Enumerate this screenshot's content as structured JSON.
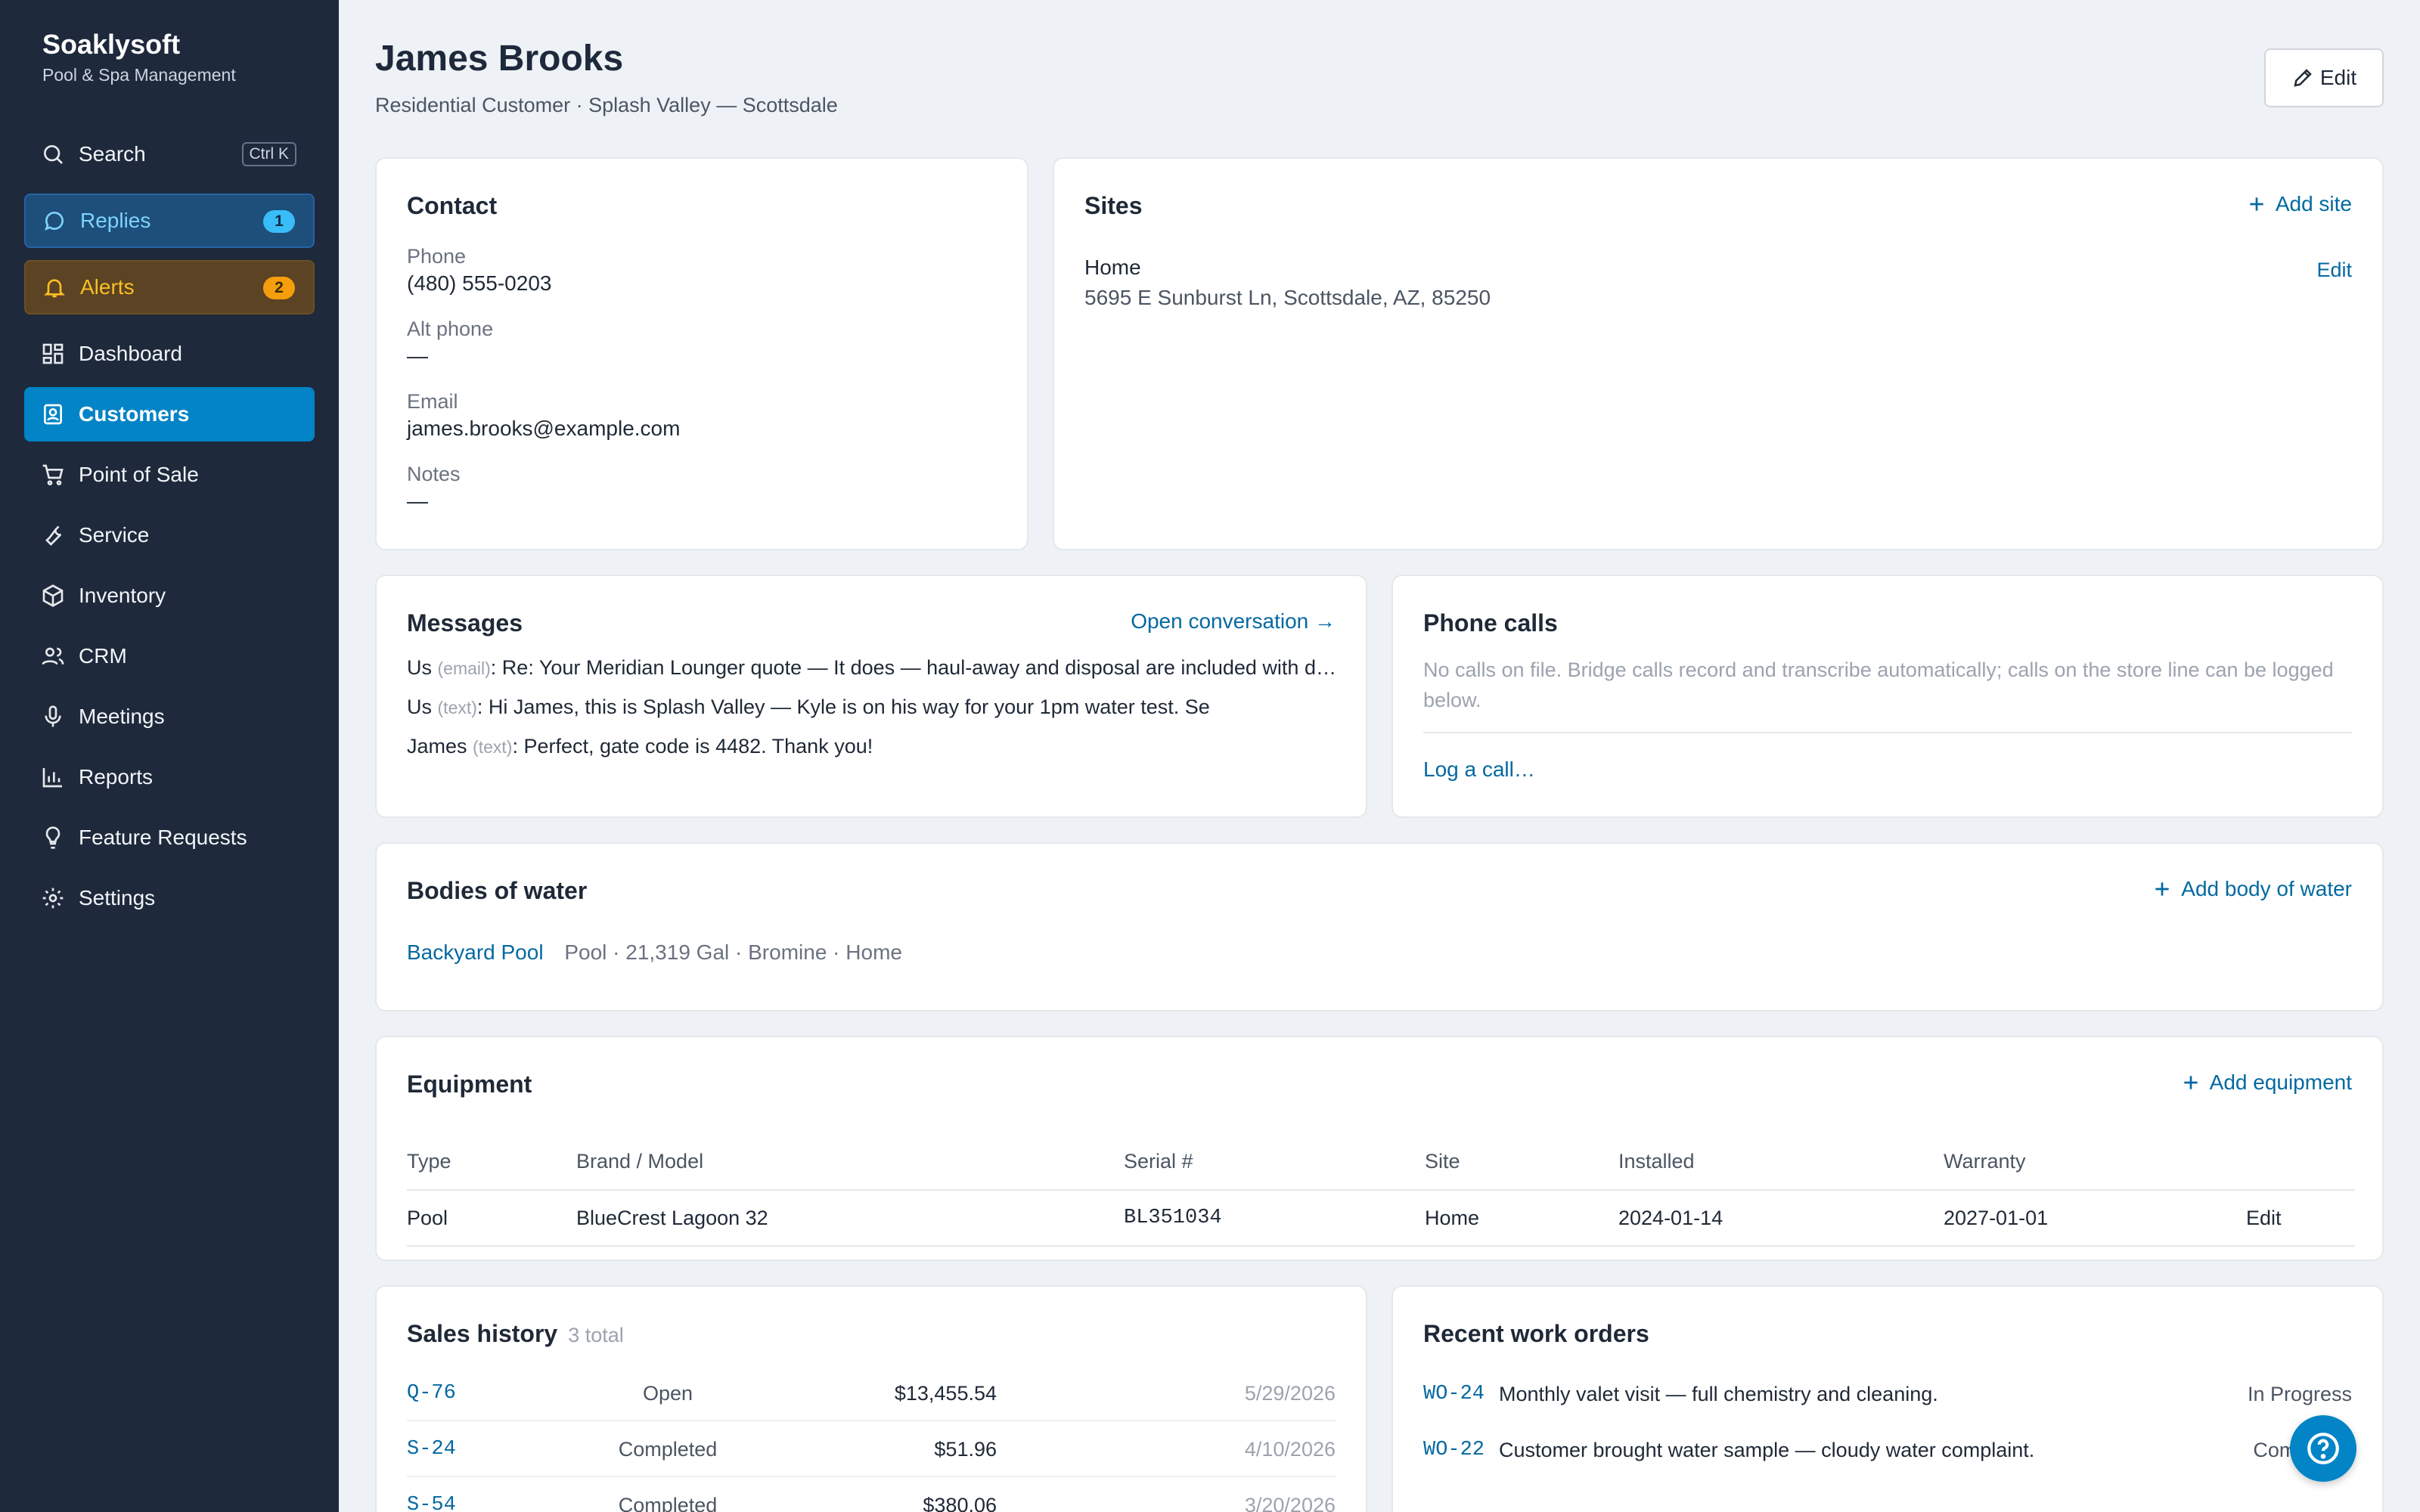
{
  "brand": {
    "name": "Soaklysoft",
    "subtitle": "Pool & Spa Management"
  },
  "sidebar": {
    "search": {
      "label": "Search",
      "shortcut": "Ctrl K"
    },
    "replies": {
      "label": "Replies",
      "count": "1"
    },
    "alerts": {
      "label": "Alerts",
      "count": "2"
    },
    "items": [
      {
        "label": "Dashboard",
        "icon": "dashboard-icon"
      },
      {
        "label": "Customers",
        "icon": "customers-icon",
        "active": true
      },
      {
        "label": "Point of Sale",
        "icon": "cart-icon"
      },
      {
        "label": "Service",
        "icon": "wrench-icon"
      },
      {
        "label": "Inventory",
        "icon": "box-icon"
      },
      {
        "label": "CRM",
        "icon": "people-icon"
      },
      {
        "label": "Meetings",
        "icon": "mic-icon"
      },
      {
        "label": "Reports",
        "icon": "chart-icon"
      },
      {
        "label": "Feature Requests",
        "icon": "lightbulb-icon"
      },
      {
        "label": "Settings",
        "icon": "gear-icon"
      }
    ]
  },
  "header": {
    "title": "James Brooks",
    "subtitle": "Residential Customer · Splash Valley — Scottsdale",
    "edit_label": "Edit"
  },
  "contact": {
    "title": "Contact",
    "phone_label": "Phone",
    "phone": "(480) 555-0203",
    "alt_phone_label": "Alt phone",
    "alt_phone": "—",
    "email_label": "Email",
    "email": "james.brooks@example.com",
    "notes_label": "Notes",
    "notes": "—"
  },
  "sites": {
    "title": "Sites",
    "add_label": "Add site",
    "items": [
      {
        "name": "Home",
        "address": "5695 E Sunburst Ln, Scottsdale, AZ, 85250",
        "edit_label": "Edit"
      }
    ]
  },
  "messages": {
    "title": "Messages",
    "open_label": "Open conversation →",
    "items": [
      {
        "from": "Us",
        "via": "(email)",
        "text": ": Re: Your Meridian Lounger quote — It does — haul-away and disposal are included with delivery."
      },
      {
        "from": "Us",
        "via": "(text)",
        "text": ": Hi James, this is Splash Valley — Kyle is on his way for your 1pm water test. Se"
      },
      {
        "from": "James",
        "via": "(text)",
        "text": ": Perfect, gate code is 4482. Thank you!"
      }
    ]
  },
  "phone_calls": {
    "title": "Phone calls",
    "empty_text": "No calls on file. Bridge calls record and transcribe automatically; calls on the store line can be logged below.",
    "log_label": "Log a call…"
  },
  "bodies": {
    "title": "Bodies of water",
    "add_label": "Add body of water",
    "items": [
      {
        "name": "Backyard Pool",
        "details": "Pool · 21,319 Gal · Bromine · Home"
      }
    ]
  },
  "equipment": {
    "title": "Equipment",
    "add_label": "Add equipment",
    "columns": [
      "Type",
      "Brand / Model",
      "Serial #",
      "Site",
      "Installed",
      "Warranty"
    ],
    "rows": [
      {
        "type": "Pool",
        "model": "BlueCrest Lagoon 32",
        "serial": "BL351034",
        "site": "Home",
        "installed": "2024-01-14",
        "warranty": "2027-01-01",
        "edit_label": "Edit"
      }
    ]
  },
  "sales": {
    "title": "Sales history",
    "count": "3 total",
    "rows": [
      {
        "id": "Q-76",
        "status": "Open",
        "amount": "$13,455.54",
        "date": "5/29/2026"
      },
      {
        "id": "S-24",
        "status": "Completed",
        "amount": "$51.96",
        "date": "4/10/2026"
      },
      {
        "id": "S-54",
        "status": "Completed",
        "amount": "$380.06",
        "date": "3/20/2026"
      }
    ]
  },
  "work_orders": {
    "title": "Recent work orders",
    "rows": [
      {
        "id": "WO-24",
        "desc": "Monthly valet visit — full chemistry and cleaning.",
        "status": "In Progress"
      },
      {
        "id": "WO-22",
        "desc": "Customer brought water sample — cloudy water complaint.",
        "status": "Completed"
      }
    ]
  },
  "colors": {
    "sidebar_bg": "#1e293b",
    "accent": "#0284c7",
    "link": "#0369a1",
    "alert": "#f59e0b",
    "page_bg": "#eef2f6"
  }
}
